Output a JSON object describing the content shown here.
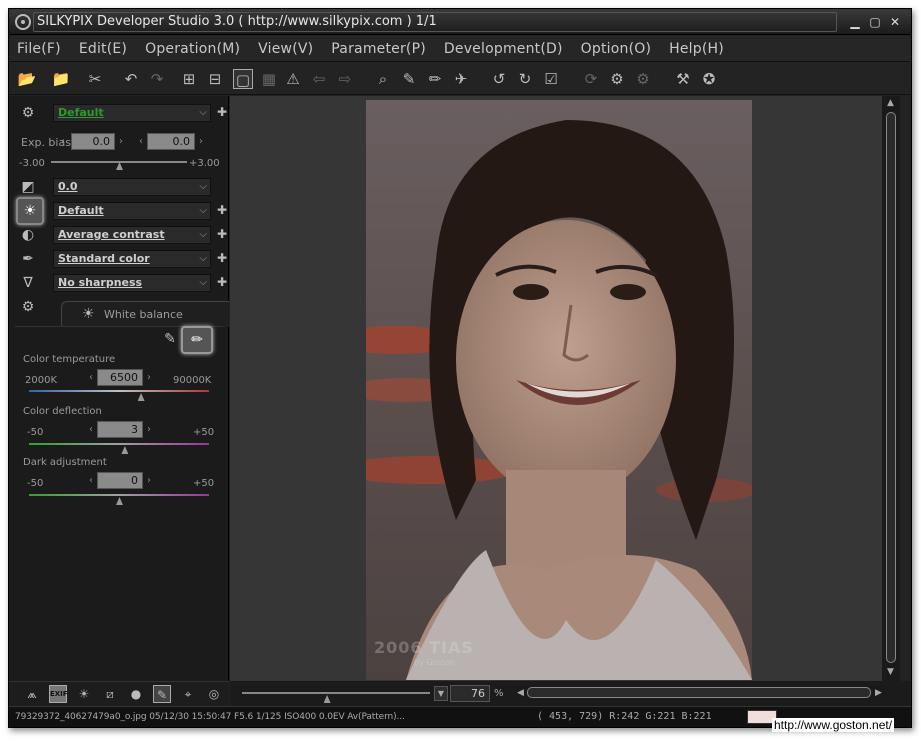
{
  "window": {
    "title": "SILKYPIX Developer Studio 3.0 ( http://www.silkypix.com )   1/1",
    "controls": {
      "minimize": "▁",
      "maximize": "▢",
      "close": "✕"
    }
  },
  "menu": [
    "File(F)",
    "Edit(E)",
    "Operation(M)",
    "View(V)",
    "Parameter(P)",
    "Development(D)",
    "Option(O)",
    "Help(H)"
  ],
  "toolbar": {
    "icons": [
      "open-folder",
      "open-folder-2",
      "eraser",
      "undo",
      "redo",
      "grid-view",
      "split-view",
      "single-view",
      "checker",
      "warning",
      "back",
      "forward",
      "zoom",
      "dropper-1",
      "dropper-2",
      "runner",
      "rotate-left",
      "rotate-right",
      "check",
      "refresh",
      "settings",
      "settings-2",
      "hammer",
      "badge"
    ]
  },
  "params": {
    "preset": {
      "value": "Default"
    },
    "exposure": {
      "label": "Exp. bias",
      "value1": "0.0",
      "value2": "0.0",
      "min": "-3.00",
      "max": "+3.00",
      "position": 0.5
    },
    "rows": [
      {
        "icon": "exposure-icon",
        "value": "0.0"
      },
      {
        "icon": "white-balance-icon",
        "value": "Default"
      },
      {
        "icon": "contrast-icon",
        "value": "Average contrast"
      },
      {
        "icon": "color-icon",
        "value": "Standard color"
      },
      {
        "icon": "sharpness-icon",
        "value": "No sharpness"
      }
    ]
  },
  "white_balance": {
    "tab_label": "White balance",
    "color_temperature": {
      "label": "Color temperature",
      "value": "6500",
      "min": "2000K",
      "max": "90000K",
      "position": 0.62
    },
    "color_deflection": {
      "label": "Color deflection",
      "value": "3",
      "min": "-50",
      "max": "+50",
      "position": 0.53
    },
    "dark_adjustment": {
      "label": "Dark adjustment",
      "value": "0",
      "min": "-50",
      "max": "+50",
      "position": 0.5
    }
  },
  "preview": {
    "photo_watermark": "2006 TIAS",
    "photo_watermark_sub": "by Goston",
    "zoom": "76",
    "zoom_unit": "%",
    "zoom_position": 0.45
  },
  "status": {
    "file_info": "79329372_40627479a0_o.jpg 05/12/30 15:50:47 F5.6 1/125 ISO400  0.0EV Av(Pattern)...",
    "coords": "( 453, 729) R:242 G:221 B:221",
    "swatch_color": "#f2dddd"
  },
  "watermark": "http://www.goston.net/",
  "colors": {
    "bg": "#222222",
    "panel": "#1b1b1b",
    "preview_bg": "#363636",
    "accent_green": "#2e9a2e"
  }
}
